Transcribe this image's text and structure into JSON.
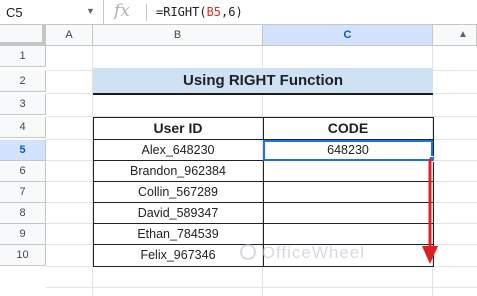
{
  "formula_bar": {
    "cell_ref": "C5",
    "fx_label": "fx",
    "formula_prefix": "=RIGHT(",
    "formula_ref": "B5",
    "formula_suffix": ",6)"
  },
  "columns": [
    "A",
    "B",
    "C"
  ],
  "rows": [
    "1",
    "2",
    "3",
    "4",
    "5",
    "6",
    "7",
    "8",
    "9",
    "10"
  ],
  "active": {
    "column": "C",
    "row": "5"
  },
  "title": "Using RIGHT Function",
  "table": {
    "headers": [
      "User ID",
      "CODE"
    ],
    "rows": [
      [
        "Alex_648230",
        "648230"
      ],
      [
        "Brandon_962384",
        ""
      ],
      [
        "Collin_567289",
        ""
      ],
      [
        "David_589347",
        ""
      ],
      [
        "Ethan_784539",
        ""
      ],
      [
        "Felix_967346",
        ""
      ]
    ]
  },
  "watermark": "OfficeWheel",
  "colors": {
    "title_fill": "#cfe2f3",
    "selection": "#1a73e8",
    "arrow": "#e02020"
  },
  "icons": {
    "name_box_caret": "chevron-down-icon",
    "function": "fx-icon",
    "arrow": "arrow-down-icon",
    "scroll": "scroll-up-icon"
  }
}
